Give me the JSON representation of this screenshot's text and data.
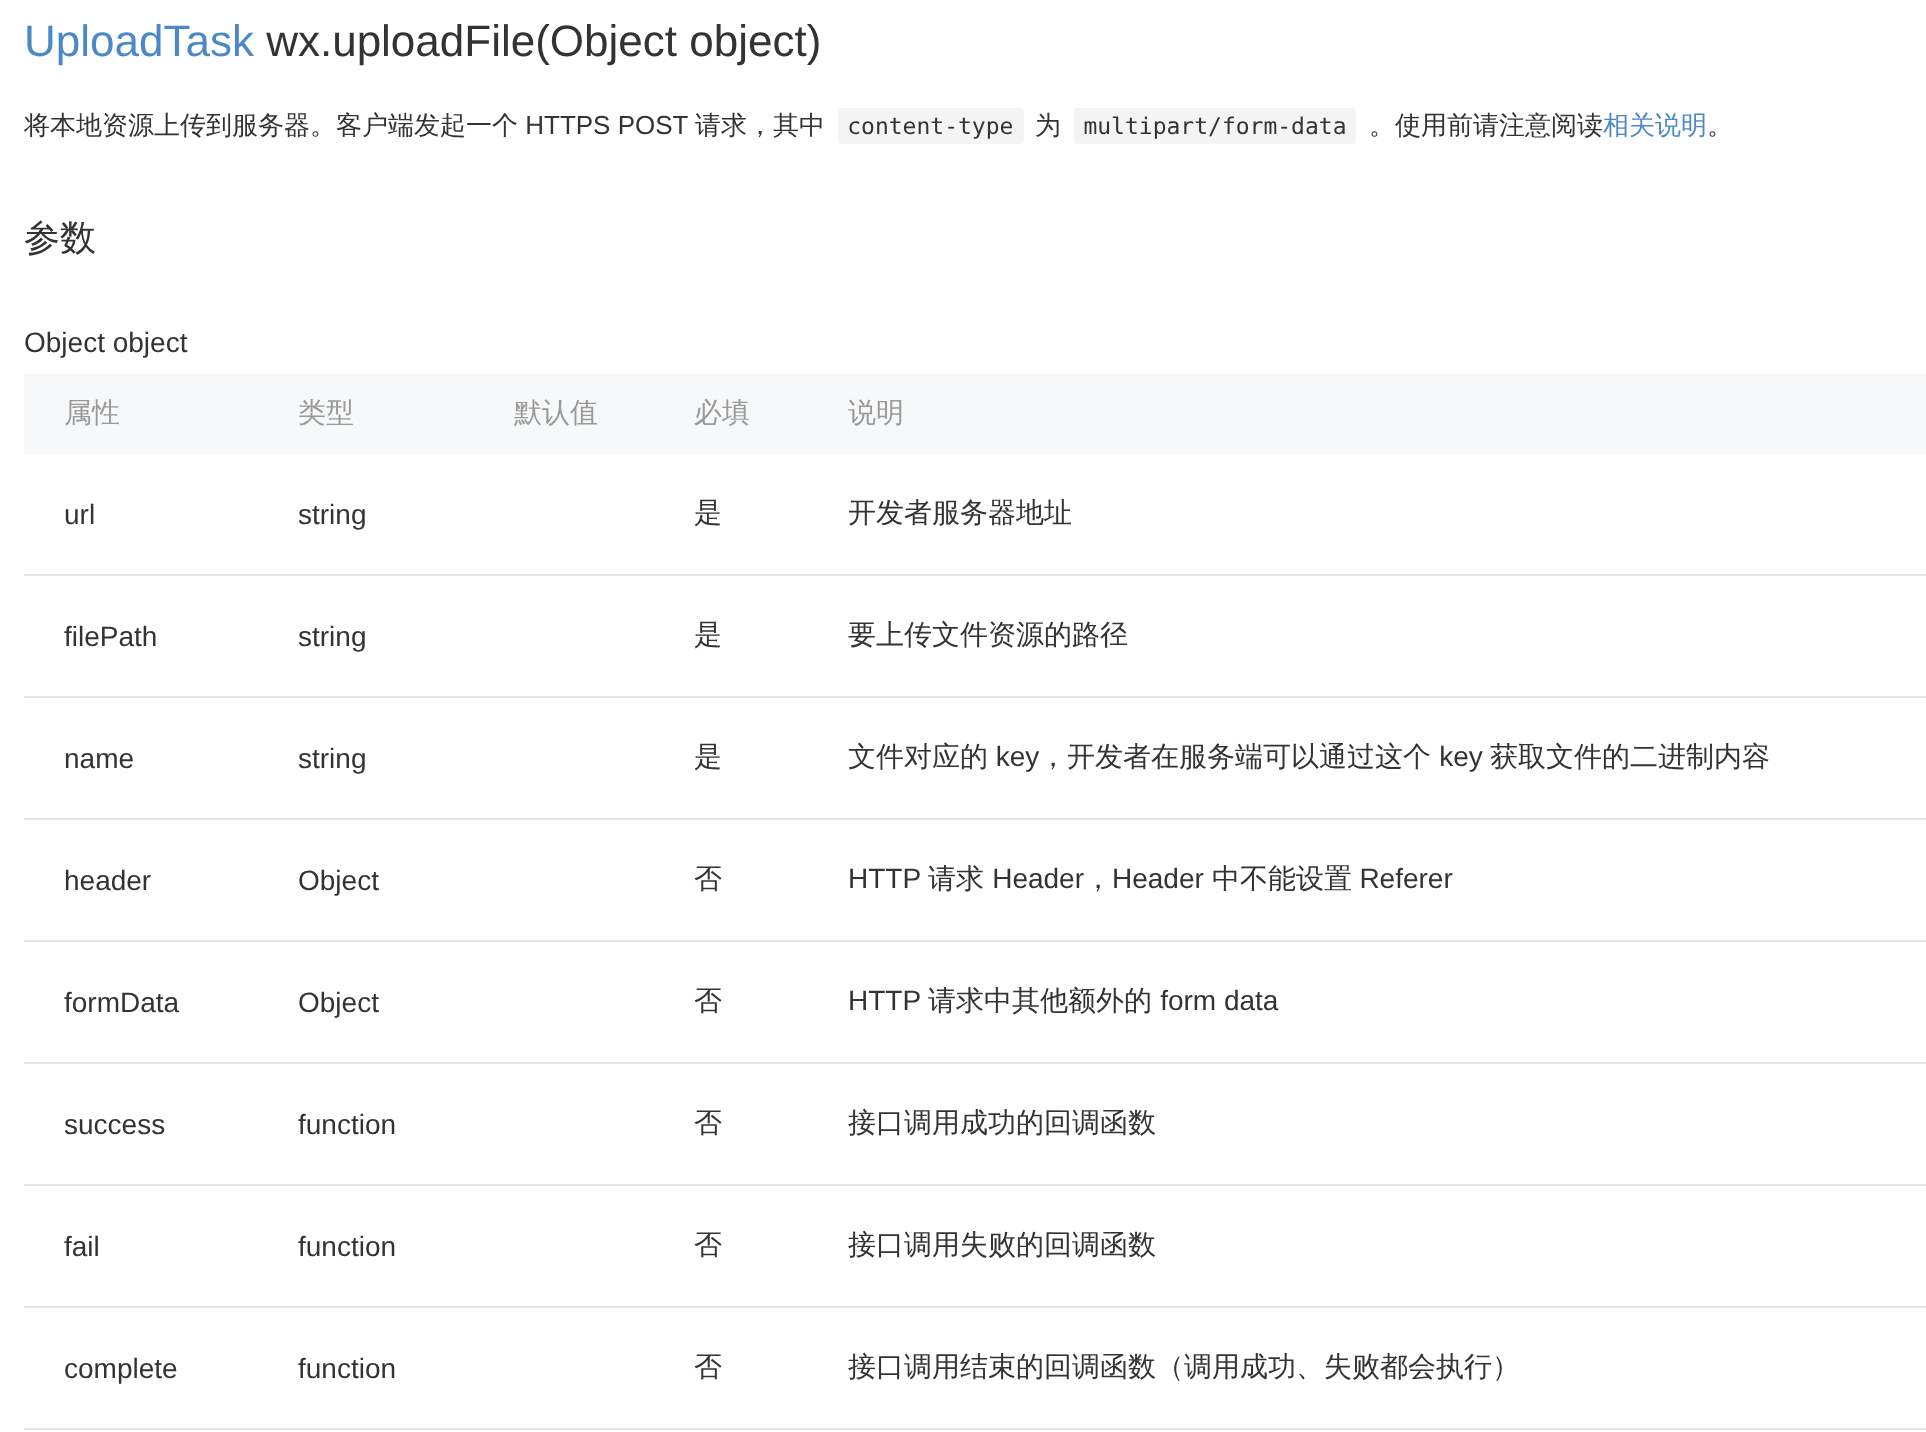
{
  "title": {
    "link": "UploadTask",
    "text": "wx.uploadFile(Object object)"
  },
  "description": [
    {
      "kind": "text",
      "text": "将本地资源上传到服务器。客户端发起一个 HTTPS POST 请求，其中"
    },
    {
      "kind": "code",
      "text": "content-type"
    },
    {
      "kind": "text",
      "text": "为"
    },
    {
      "kind": "code",
      "text": "multipart/form-data"
    },
    {
      "kind": "text",
      "text": "。使用前请注意阅读"
    },
    {
      "kind": "link",
      "text": "相关说明"
    },
    {
      "kind": "text",
      "text": "。"
    }
  ],
  "section_heading": "参数",
  "param_label": "Object object",
  "table": {
    "columns": [
      "属性",
      "类型",
      "默认值",
      "必填",
      "说明"
    ],
    "rows": [
      {
        "cells": [
          "url",
          "string",
          "",
          "是",
          "开发者服务器地址"
        ]
      },
      {
        "cells": [
          "filePath",
          "string",
          "",
          "是",
          "要上传文件资源的路径"
        ]
      },
      {
        "cells": [
          "name",
          "string",
          "",
          "是",
          "文件对应的 key，开发者在服务端可以通过这个 key 获取文件的二进制内容"
        ]
      },
      {
        "cells": [
          "header",
          "Object",
          "",
          "否",
          "HTTP 请求 Header，Header 中不能设置 Referer"
        ]
      },
      {
        "cells": [
          "formData",
          "Object",
          "",
          "否",
          "HTTP 请求中其他额外的 form data"
        ]
      },
      {
        "cells": [
          "success",
          "function",
          "",
          "否",
          "接口调用成功的回调函数"
        ]
      },
      {
        "cells": [
          "fail",
          "function",
          "",
          "否",
          "接口调用失败的回调函数"
        ]
      },
      {
        "cells": [
          "complete",
          "function",
          "",
          "否",
          "接口调用结束的回调函数（调用成功、失败都会执行）"
        ]
      }
    ]
  }
}
